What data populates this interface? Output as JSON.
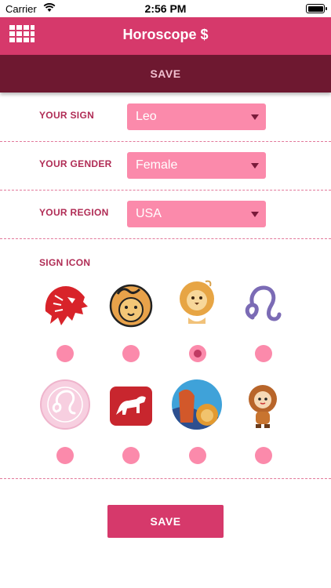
{
  "status_bar": {
    "carrier": "Carrier",
    "time": "2:56 PM"
  },
  "nav": {
    "title": "Horoscope $",
    "menu_icon": "grid-menu-icon"
  },
  "top_save": {
    "label": "SAVE"
  },
  "form": {
    "sign": {
      "label": "YOUR SIGN",
      "value": "Leo"
    },
    "gender": {
      "label": "YOUR GENDER",
      "value": "Female"
    },
    "region": {
      "label": "YOUR REGION",
      "value": "USA"
    }
  },
  "sign_icon": {
    "label": "SIGN ICON",
    "selected_index": 2,
    "icons": [
      "red-lion-head-icon",
      "leo-symbol-lion-badge-icon",
      "cartoon-lion-icon",
      "leo-glyph-icon",
      "pink-leo-medallion-icon",
      "red-lion-stamp-icon",
      "lion-woman-painting-icon",
      "lion-costume-kid-icon"
    ]
  },
  "bottom_save": {
    "label": "SAVE"
  },
  "colors": {
    "primary": "#d6396b",
    "dark": "#6e1830",
    "select_bg": "#fb8aab",
    "label": "#b02c55"
  }
}
